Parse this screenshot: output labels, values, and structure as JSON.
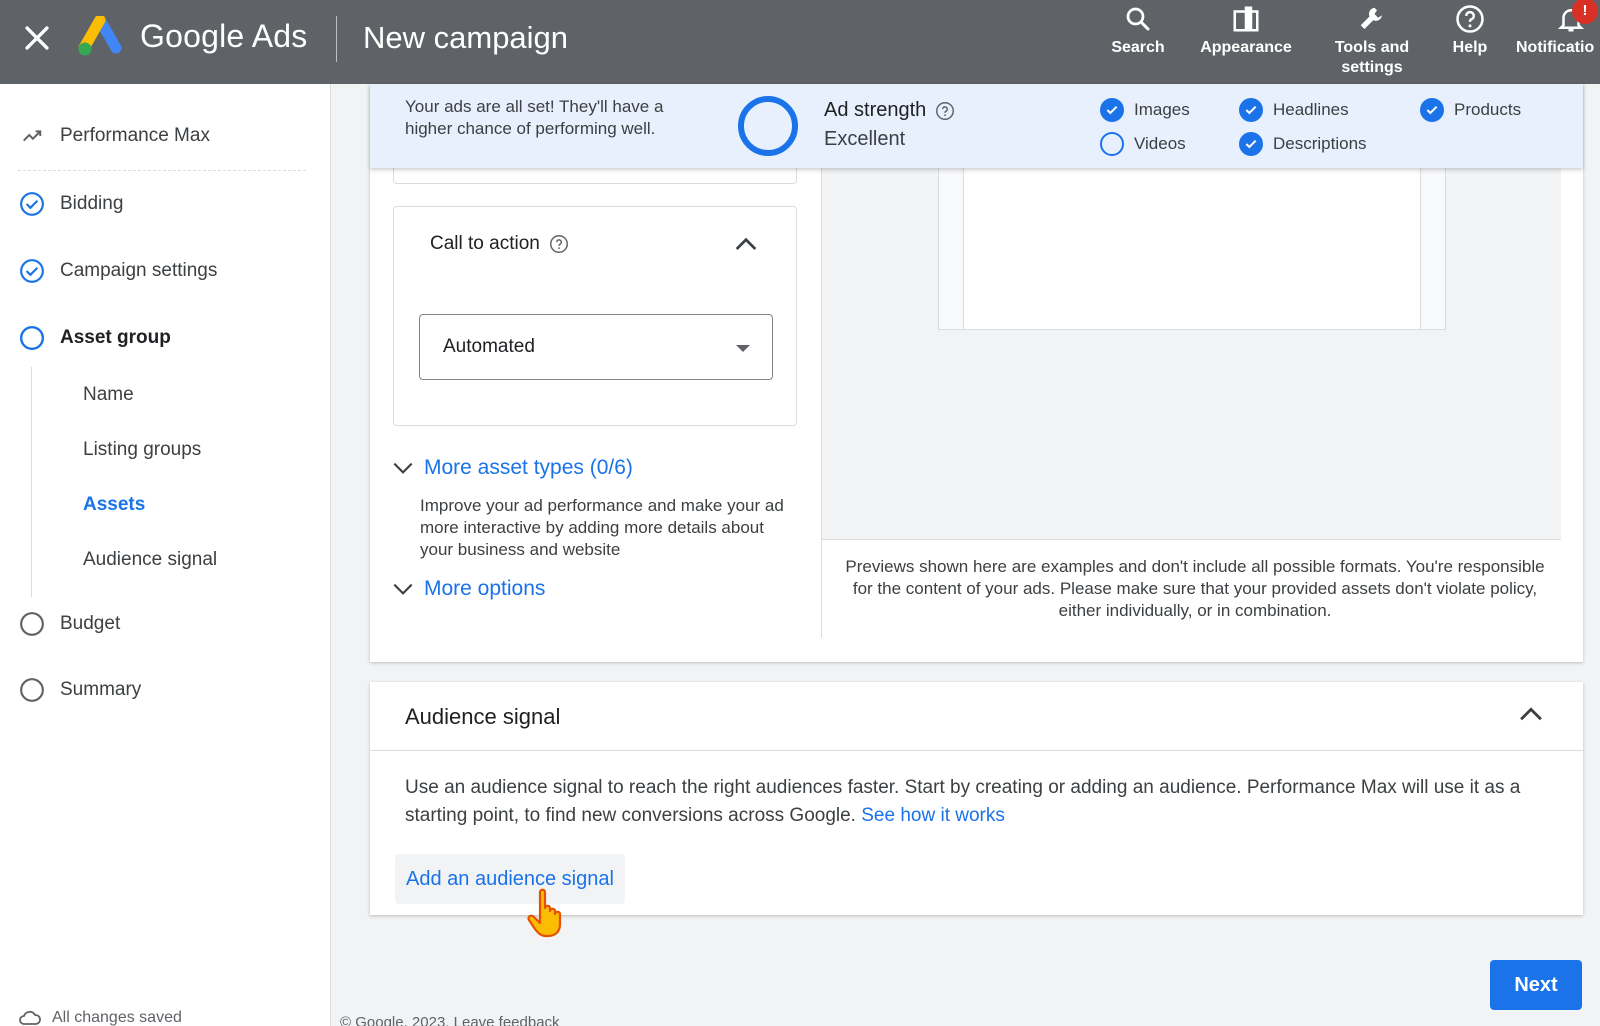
{
  "header": {
    "brand": "Google Ads",
    "title": "New campaign",
    "nav": [
      {
        "label": "Search",
        "icon": "search-icon"
      },
      {
        "label": "Appearance",
        "icon": "appearance-icon"
      },
      {
        "label": "Tools and settings",
        "icon": "wrench-icon"
      },
      {
        "label": "Help",
        "icon": "help-icon"
      },
      {
        "label": "Notificatio",
        "icon": "bell-icon"
      }
    ],
    "notification_badge": "!"
  },
  "sidebar": {
    "items": [
      {
        "label": "Performance Max",
        "icon": "performance-icon"
      },
      {
        "label": "Bidding",
        "icon": "check-circle-icon"
      },
      {
        "label": "Campaign settings",
        "icon": "check-circle-icon"
      },
      {
        "label": "Asset group",
        "icon": "circle-icon"
      },
      {
        "label": "Budget",
        "icon": "circle-icon"
      },
      {
        "label": "Summary",
        "icon": "circle-icon"
      }
    ],
    "sub_items": [
      {
        "label": "Name"
      },
      {
        "label": "Listing groups"
      },
      {
        "label": "Assets"
      },
      {
        "label": "Audience signal"
      }
    ],
    "saved_status": "All changes saved"
  },
  "ad_strength": {
    "message": "Your ads are all set! They'll have a higher chance of performing well.",
    "label": "Ad strength",
    "value": "Excellent",
    "checks": [
      {
        "label": "Images",
        "done": true
      },
      {
        "label": "Headlines",
        "done": true
      },
      {
        "label": "Products",
        "done": true
      },
      {
        "label": "Videos",
        "done": false
      },
      {
        "label": "Descriptions",
        "done": true
      }
    ]
  },
  "call_to_action": {
    "title": "Call to action",
    "selected": "Automated"
  },
  "more_asset_types": {
    "label": "More asset types (0/6)",
    "description": "Improve your ad performance and make your ad more interactive by adding more details about your business and website"
  },
  "more_options": {
    "label": "More options"
  },
  "preview_note": "Previews shown here are examples and don't include all possible formats. You're responsible for the content of your ads. Please make sure that your provided assets don't violate policy, either individually, or in combination.",
  "audience_signal": {
    "title": "Audience signal",
    "description": "Use an audience signal to reach the right audiences faster. Start by creating or adding an audience. Performance Max will use it as a starting point, to find new conversions across Google.",
    "link": "See how it works",
    "add_button": "Add an audience signal"
  },
  "footer": {
    "next": "Next",
    "copyright": "© Google, 2023.  Leave feedback"
  },
  "colors": {
    "accent": "#1a73e8",
    "topbar": "#5f6368",
    "strength_bg": "#e8f0fe",
    "badge": "#d93025"
  }
}
